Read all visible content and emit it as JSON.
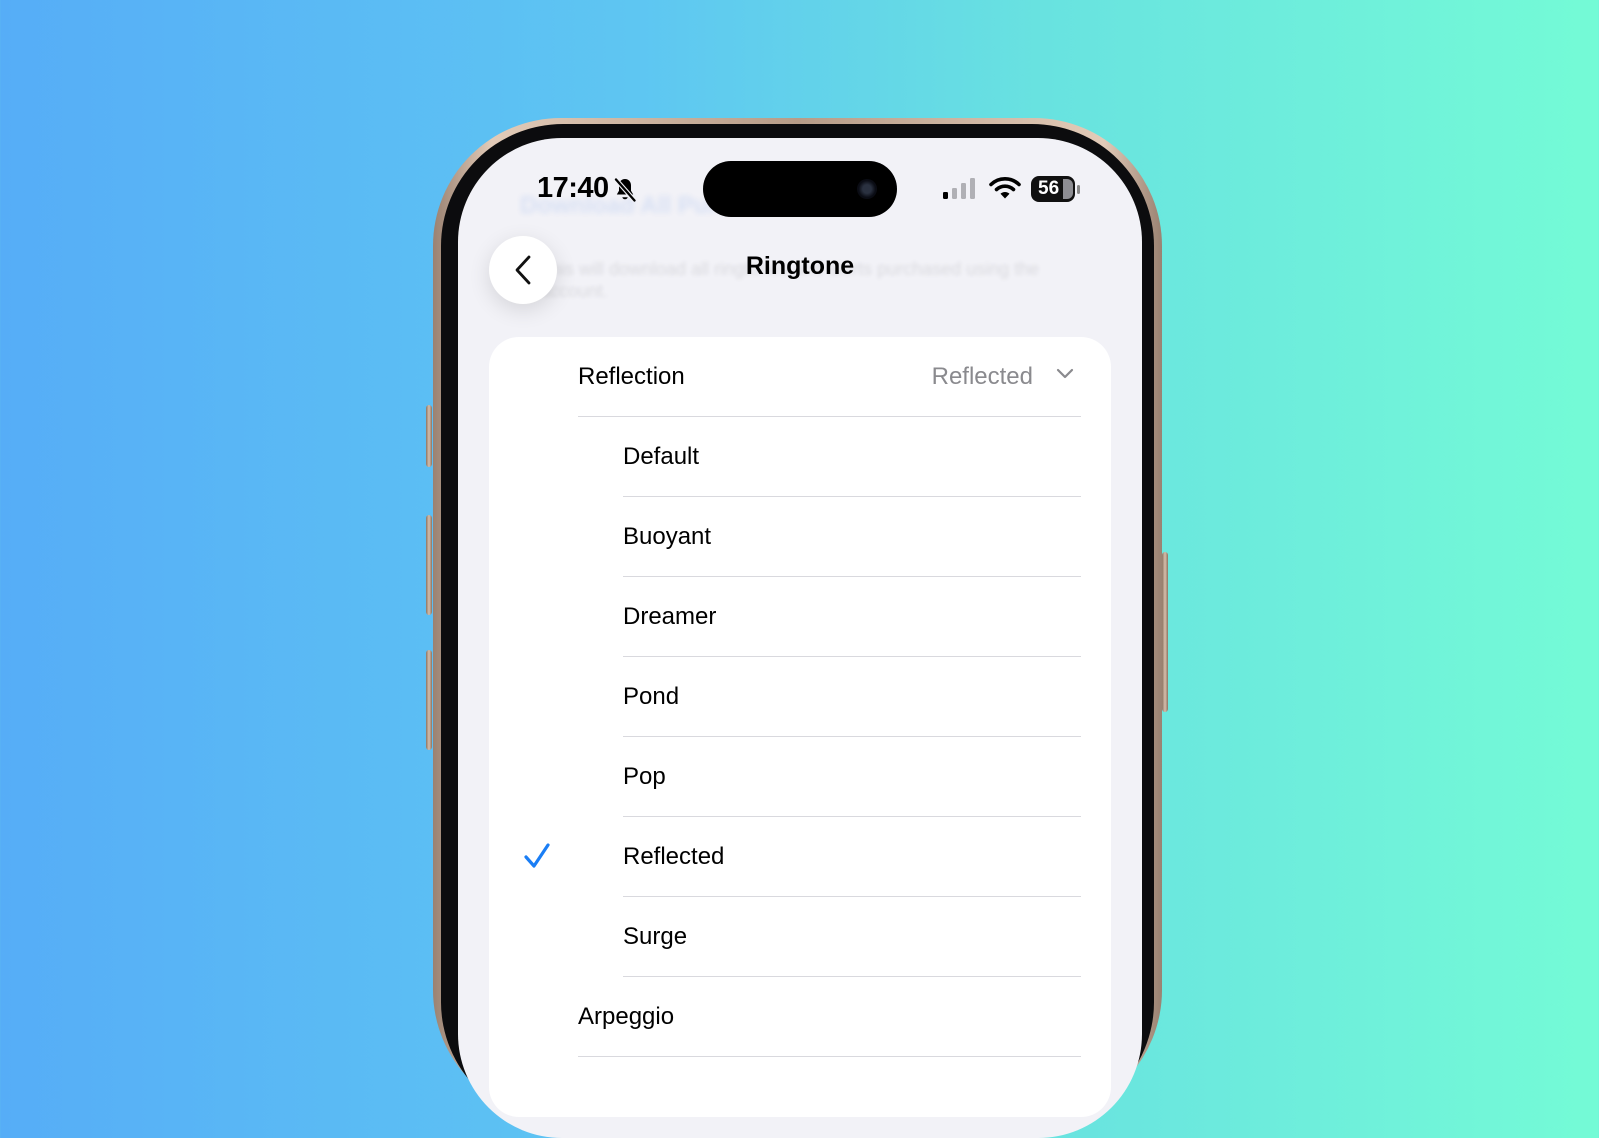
{
  "status_bar": {
    "time": "17:40",
    "battery": "56"
  },
  "background_hint": {
    "title": "Download All Purchases",
    "body": "This will download all ringtones and alerts purchased using the account."
  },
  "nav": {
    "title": "Ringtone"
  },
  "section": {
    "label": "Reflection",
    "value": "Reflected"
  },
  "options": [
    {
      "label": "Default",
      "selected": false
    },
    {
      "label": "Buoyant",
      "selected": false
    },
    {
      "label": "Dreamer",
      "selected": false
    },
    {
      "label": "Pond",
      "selected": false
    },
    {
      "label": "Pop",
      "selected": false
    },
    {
      "label": "Reflected",
      "selected": true
    },
    {
      "label": "Surge",
      "selected": false
    }
  ],
  "next_ringtone": {
    "label": "Arpeggio"
  },
  "colors": {
    "accent": "#1a7ef5",
    "secondary_text": "#8a8a8e",
    "divider": "#d9d9de"
  },
  "icons": {
    "back": "chevron-left-icon",
    "mute": "bell-slash-icon",
    "signal": "cellular-signal-icon",
    "wifi": "wifi-icon",
    "disclosure": "chevron-down-icon",
    "selected": "checkmark-icon"
  }
}
